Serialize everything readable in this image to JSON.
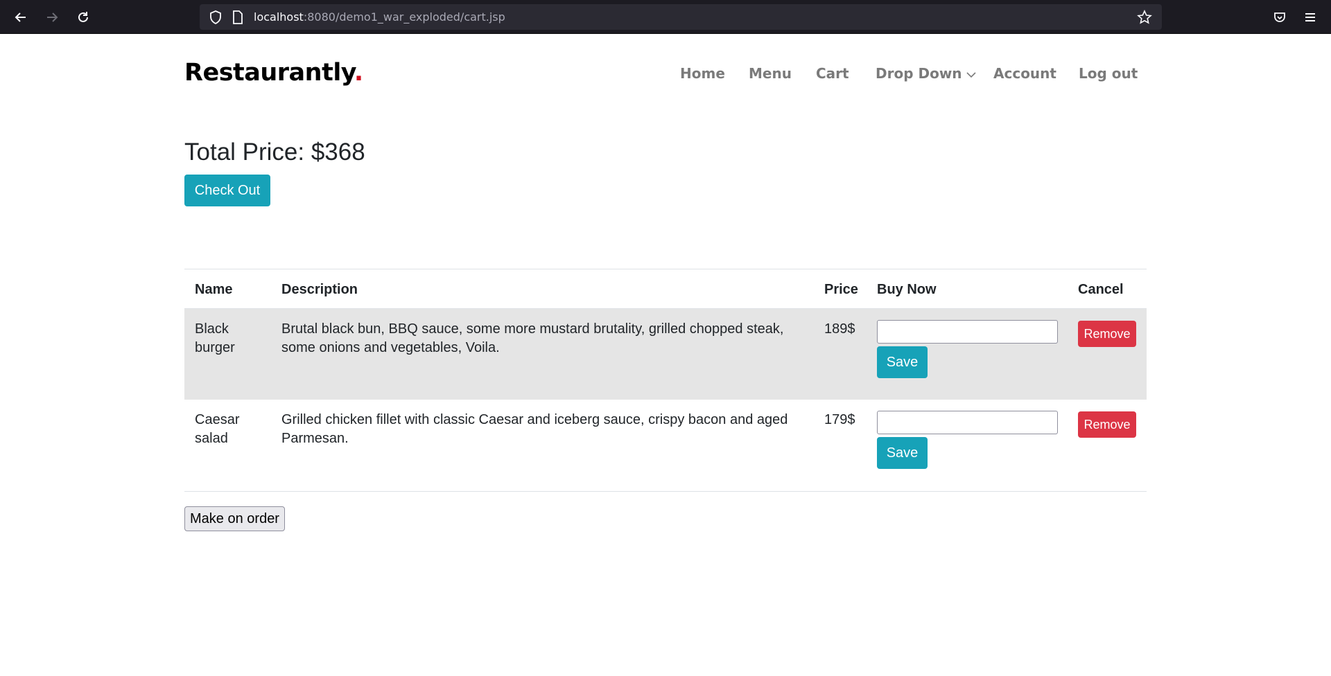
{
  "browser": {
    "url_host": "localhost",
    "url_rest": ":8080/demo1_war_exploded/cart.jsp"
  },
  "brand": {
    "name": "Restaurantly",
    "dot": "."
  },
  "nav": {
    "items": [
      {
        "label": "Home"
      },
      {
        "label": "Menu"
      },
      {
        "label": "Cart"
      },
      {
        "label": "Drop Down"
      },
      {
        "label": "Account"
      },
      {
        "label": "Log out"
      }
    ]
  },
  "cart": {
    "total_label": "Total Price: $368",
    "checkout_label": "Check Out",
    "columns": [
      "Name",
      "Description",
      "Price",
      "Buy Now",
      "Cancel"
    ],
    "rows": [
      {
        "name": "Black burger",
        "description": "Brutal black bun, BBQ sauce, some more mustard brutality, grilled chopped steak, some onions and vegetables, Voila.",
        "price": "189$",
        "qty_value": "",
        "save_label": "Save",
        "remove_label": "Remove"
      },
      {
        "name": "Caesar salad",
        "description": "Grilled chicken fillet with classic Caesar and iceberg sauce, crispy bacon and aged Parmesan.",
        "price": "179$",
        "qty_value": "",
        "save_label": "Save",
        "remove_label": "Remove"
      }
    ],
    "order_label": "Make on order"
  },
  "colors": {
    "accent": "#17a2b8",
    "danger": "#dc3545",
    "brand_dot": "#d00f20"
  }
}
